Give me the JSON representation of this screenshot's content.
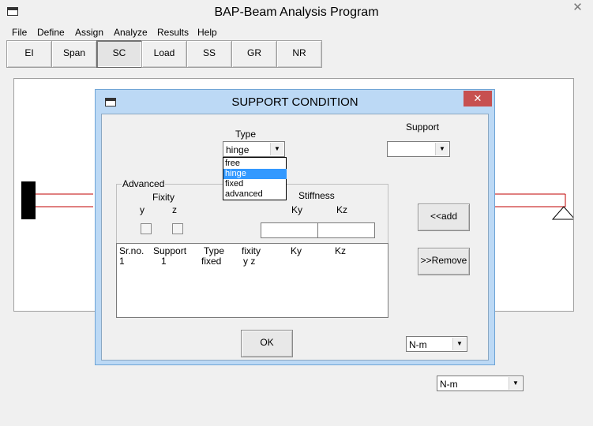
{
  "window": {
    "title": "BAP-Beam Analysis Program",
    "close_glyph": "✕"
  },
  "menu": [
    "File",
    "Define",
    "Assign",
    "Analyze",
    "Results",
    "Help"
  ],
  "toolbar": [
    {
      "label": "EI"
    },
    {
      "label": "Span"
    },
    {
      "label": "SC"
    },
    {
      "label": "Load"
    },
    {
      "label": "SS"
    },
    {
      "label": "GR"
    },
    {
      "label": "NR"
    }
  ],
  "units_main": "N-m",
  "dialog": {
    "title": "SUPPORT CONDITION",
    "close_glyph": "✕",
    "type_label": "Type",
    "type_value": "hinge",
    "type_options": [
      "free",
      "hinge",
      "fixed",
      "advanced"
    ],
    "support_label": "Support",
    "support_value": "",
    "advanced_label": "Advanced",
    "fixity_label": "Fixity",
    "fixity_y": "y",
    "fixity_z": "z",
    "stiffness_label": "Stiffness",
    "ky_label": "Ky",
    "kz_label": "Kz",
    "ky_value": "",
    "kz_value": "",
    "add_label": "<<add",
    "remove_label": ">>Remove",
    "ok_label": "OK",
    "units": "N-m",
    "table": {
      "headers": [
        "Sr.no.",
        "Support",
        "Type",
        "fixity",
        "Ky",
        "Kz"
      ],
      "rows": [
        [
          "1",
          "1",
          "fixed",
          "y z",
          "",
          ""
        ]
      ]
    }
  }
}
